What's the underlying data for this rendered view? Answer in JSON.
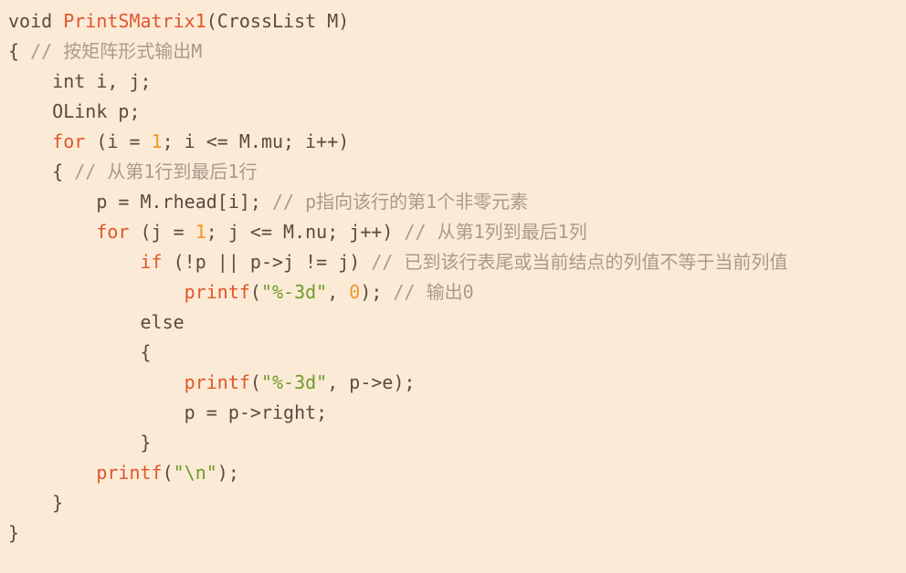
{
  "code": {
    "l1": {
      "t1": "void ",
      "fn": "PrintSMatrix1",
      "t2": "(CrossList M)"
    },
    "l2": {
      "t1": "{ ",
      "cm": "// 按矩阵形式输出M"
    },
    "l3": {
      "t1": "    int i, j;"
    },
    "l4": {
      "t1": "    OLink p;"
    },
    "l5": {
      "ind": "    ",
      "kw": "for",
      "t1": " (i = ",
      "n1": "1",
      "t2": "; i <= M.mu; i++)"
    },
    "l6": {
      "t1": "    { ",
      "cm": "// 从第1行到最后1行"
    },
    "l7": {
      "t1": "        p = M.rhead[i]; ",
      "cm": "// p指向该行的第1个非零元素"
    },
    "l8": {
      "ind": "        ",
      "kw": "for",
      "t1": " (j = ",
      "n1": "1",
      "t2": "; j <= M.nu; j++) ",
      "cm": "// 从第1列到最后1列"
    },
    "l9": {
      "ind": "            ",
      "kw": "if",
      "t1": " (!p || p->j != j) ",
      "cm": "// 已到该行表尾或当前结点的列值不等于当前列值"
    },
    "l10": {
      "ind": "                ",
      "fn": "printf",
      "t1": "(",
      "str": "\"%-3d\"",
      "t2": ", ",
      "n1": "0",
      "t3": "); ",
      "cm": "// 输出0"
    },
    "l11": {
      "t1": "            else"
    },
    "l12": {
      "t1": "            {"
    },
    "l13": {
      "ind": "                ",
      "fn": "printf",
      "t1": "(",
      "str": "\"%-3d\"",
      "t2": ", p->e);"
    },
    "l14": {
      "t1": "                p = p->right;"
    },
    "l15": {
      "t1": "            }"
    },
    "l16": {
      "ind": "        ",
      "fn": "printf",
      "t1": "(",
      "str": "\"\\n\"",
      "t2": ");"
    },
    "l17": {
      "t1": "    }"
    },
    "l18": {
      "t1": "}"
    }
  },
  "colors": {
    "background": "#fbead6",
    "text": "#5b4a3f",
    "keyword": "#e0562b",
    "number": "#f0962c",
    "string": "#6f9a2d",
    "comment": "#a99a8d"
  }
}
